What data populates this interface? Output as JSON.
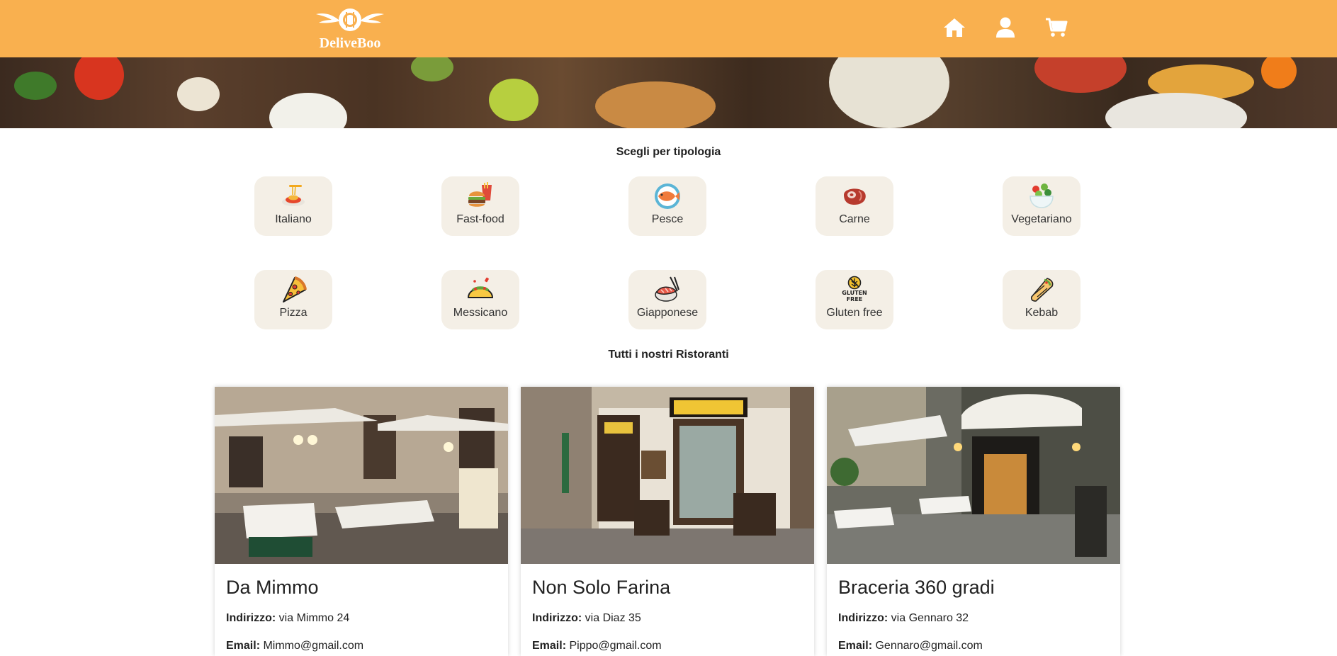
{
  "header": {
    "logo_text": "DeliveBoo",
    "nav": [
      {
        "icon": "home-icon"
      },
      {
        "icon": "user-icon"
      },
      {
        "icon": "cart-icon"
      }
    ]
  },
  "categories_section": {
    "title": "Scegli per tipologia",
    "items": [
      {
        "label": "Italiano",
        "icon": "pasta-icon"
      },
      {
        "label": "Fast-food",
        "icon": "burger-fries-icon"
      },
      {
        "label": "Pesce",
        "icon": "fish-plate-icon"
      },
      {
        "label": "Carne",
        "icon": "meat-icon"
      },
      {
        "label": "Vegetariano",
        "icon": "salad-icon"
      },
      {
        "label": "Pizza",
        "icon": "pizza-icon"
      },
      {
        "label": "Messicano",
        "icon": "taco-icon"
      },
      {
        "label": "Giapponese",
        "icon": "sushi-icon"
      },
      {
        "label": "Gluten free",
        "icon": "gluten-free-icon"
      },
      {
        "label": "Kebab",
        "icon": "kebab-icon"
      }
    ],
    "gluten_badge": {
      "line1": "GLUTEN",
      "line2": "FREE"
    }
  },
  "restaurants_section": {
    "title": "Tutti i nostri Ristoranti",
    "address_label": "Indirizzo:",
    "email_label": "Email:",
    "items": [
      {
        "name": "Da Mimmo",
        "address": "via Mimmo 24",
        "email": "Mimmo@gmail.com"
      },
      {
        "name": "Non Solo Farina",
        "address": "via Diaz 35",
        "email": "Pippo@gmail.com"
      },
      {
        "name": "Braceria 360 gradi",
        "address": "via Gennaro 32",
        "email": "Gennaro@gmail.com"
      }
    ]
  },
  "colors": {
    "header_bg": "#f9b04f",
    "category_bg": "#f4efe6"
  }
}
